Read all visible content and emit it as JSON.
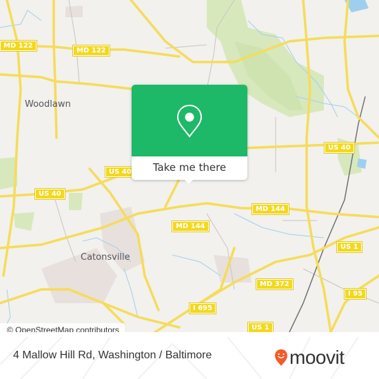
{
  "map": {
    "road_labels": [
      {
        "text": "MD 122",
        "id": "md122-west"
      },
      {
        "text": "MD 122",
        "id": "md122-center"
      },
      {
        "text": "US 40",
        "id": "us40-center"
      },
      {
        "text": "US 40",
        "id": "us40-west"
      },
      {
        "text": "US 40",
        "id": "us40-east"
      },
      {
        "text": "MD 144",
        "id": "md144-center"
      },
      {
        "text": "MD 144",
        "id": "md144-east"
      },
      {
        "text": "US 1",
        "id": "us1-north"
      },
      {
        "text": "MD 372",
        "id": "md372"
      },
      {
        "text": "I 695",
        "id": "i695"
      },
      {
        "text": "I 95",
        "id": "i95"
      },
      {
        "text": "US 1",
        "id": "us1-south"
      }
    ],
    "places": [
      "Woodlawn",
      "Catonsville"
    ],
    "colors": {
      "land": "#f2f1ed",
      "road": "#f5dc5a",
      "park": "#d8e8bd",
      "water": "#9fcfef",
      "urban": "#e8e0dd"
    }
  },
  "popup": {
    "action_label": "Take me there",
    "icon": "map-pin-icon",
    "color": "#1db868"
  },
  "attribution": "© OpenStreetMap contributors",
  "footer": {
    "address": "4 Mallow Hill Rd, Washington / Baltimore",
    "brand": "moovit",
    "brand_color": "#f25c2a"
  }
}
